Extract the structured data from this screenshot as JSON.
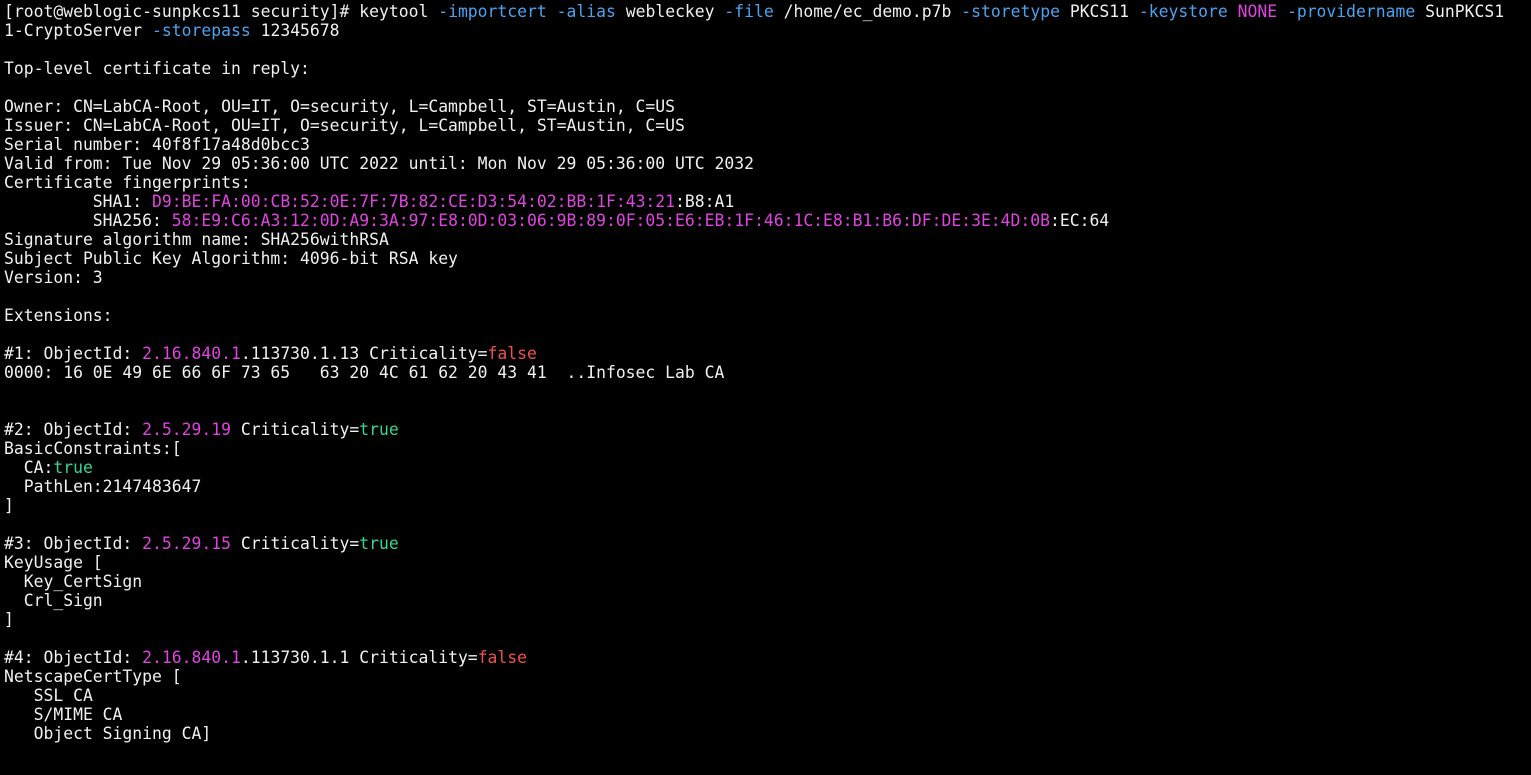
{
  "colors": {
    "background": "#000000",
    "default": "#f0f0f0",
    "flag": "#4aa3f0",
    "magenta": "#e044e0",
    "red": "#f05050",
    "green": "#36d68e",
    "yellow": "#e2e25e"
  },
  "lines": [
    [
      {
        "t": "[root@weblogic-sunpkcs11 security]# keytool ",
        "c": "default"
      },
      {
        "t": "-importcert",
        "c": "flag"
      },
      {
        "t": " ",
        "c": "default"
      },
      {
        "t": "-alias",
        "c": "flag"
      },
      {
        "t": " webleckey ",
        "c": "default"
      },
      {
        "t": "-file",
        "c": "flag"
      },
      {
        "t": " /home/ec_demo.p7b ",
        "c": "default"
      },
      {
        "t": "-storetype",
        "c": "flag"
      },
      {
        "t": " PKCS11 ",
        "c": "default"
      },
      {
        "t": "-keystore",
        "c": "flag"
      },
      {
        "t": " ",
        "c": "default"
      },
      {
        "t": "NONE",
        "c": "magenta"
      },
      {
        "t": " ",
        "c": "default"
      },
      {
        "t": "-providername",
        "c": "flag"
      },
      {
        "t": " SunPKCS1",
        "c": "default"
      }
    ],
    [
      {
        "t": "1-CryptoServer ",
        "c": "default"
      },
      {
        "t": "-storepass",
        "c": "flag"
      },
      {
        "t": " 12345678",
        "c": "default"
      }
    ],
    [],
    [
      {
        "t": "Top-level certificate in reply:",
        "c": "default"
      }
    ],
    [],
    [
      {
        "t": "Owner: CN=LabCA-Root, OU=IT, O=security, L=Campbell, ST=Austin, C=US",
        "c": "default"
      }
    ],
    [
      {
        "t": "Issuer: CN=LabCA-Root, OU=IT, O=security, L=Campbell, ST=Austin, C=US",
        "c": "default"
      }
    ],
    [
      {
        "t": "Serial number: 40f8f17a48d0bcc3",
        "c": "default"
      }
    ],
    [
      {
        "t": "Valid from: Tue Nov 29 05:36:00 UTC 2022 until: Mon Nov 29 05:36:00 UTC 2032",
        "c": "default"
      }
    ],
    [
      {
        "t": "Certificate fingerprints:",
        "c": "default"
      }
    ],
    [
      {
        "t": "         SHA1: ",
        "c": "default"
      },
      {
        "t": "D9:BE:FA:00:CB:52:0E:7F:7B:82:CE:D3:54:02:BB:1F:43:21",
        "c": "magenta"
      },
      {
        "t": ":B8:A1",
        "c": "default"
      }
    ],
    [
      {
        "t": "         SHA256: ",
        "c": "default"
      },
      {
        "t": "58:E9:C6:A3:12:0D:A9:3A:97:E8:0D:03:06:9B:89:0F:05:E6:EB:1F:46:1C:E8:B1:B6:DF:DE:3E:4D:0B",
        "c": "magenta"
      },
      {
        "t": ":EC:64",
        "c": "default"
      }
    ],
    [
      {
        "t": "Signature algorithm name: SHA256withRSA",
        "c": "default"
      }
    ],
    [
      {
        "t": "Subject Public Key Algorithm: 4096-bit RSA key",
        "c": "default"
      }
    ],
    [
      {
        "t": "Version: 3",
        "c": "default"
      }
    ],
    [],
    [
      {
        "t": "Extensions:",
        "c": "default"
      }
    ],
    [],
    [
      {
        "t": "#1: ObjectId: ",
        "c": "default"
      },
      {
        "t": "2.16.840.1",
        "c": "magenta"
      },
      {
        "t": ".113730.1.13 Criticality=",
        "c": "default"
      },
      {
        "t": "false",
        "c": "red"
      }
    ],
    [
      {
        "t": "0000: 16 0E 49 6E 66 6F 73 65   63 20 4C 61 62 20 43 41  ..Infosec Lab CA",
        "c": "default"
      }
    ],
    [],
    [],
    [
      {
        "t": "#2: ObjectId: ",
        "c": "default"
      },
      {
        "t": "2.5.29.19",
        "c": "magenta"
      },
      {
        "t": " Criticality=",
        "c": "default"
      },
      {
        "t": "true",
        "c": "green"
      }
    ],
    [
      {
        "t": "BasicConstraints:[",
        "c": "default"
      }
    ],
    [
      {
        "t": "  CA:",
        "c": "default"
      },
      {
        "t": "true",
        "c": "green"
      }
    ],
    [
      {
        "t": "  PathLen:2147483647",
        "c": "default"
      }
    ],
    [
      {
        "t": "]",
        "c": "default"
      }
    ],
    [],
    [
      {
        "t": "#3: ObjectId: ",
        "c": "default"
      },
      {
        "t": "2.5.29.15",
        "c": "magenta"
      },
      {
        "t": " Criticality=",
        "c": "default"
      },
      {
        "t": "true",
        "c": "green"
      }
    ],
    [
      {
        "t": "KeyUsage [",
        "c": "default"
      }
    ],
    [
      {
        "t": "  Key_CertSign",
        "c": "default"
      }
    ],
    [
      {
        "t": "  Crl_Sign",
        "c": "default"
      }
    ],
    [
      {
        "t": "]",
        "c": "default"
      }
    ],
    [],
    [
      {
        "t": "#4: ObjectId: ",
        "c": "default"
      },
      {
        "t": "2.16.840.1",
        "c": "magenta"
      },
      {
        "t": ".113730.1.1 Criticality=",
        "c": "default"
      },
      {
        "t": "false",
        "c": "red"
      }
    ],
    [
      {
        "t": "NetscapeCertType [",
        "c": "default"
      }
    ],
    [
      {
        "t": "   SSL CA",
        "c": "default"
      }
    ],
    [
      {
        "t": "   S/MIME CA",
        "c": "default"
      }
    ],
    [
      {
        "t": "   Object Signing CA]",
        "c": "default"
      }
    ]
  ]
}
